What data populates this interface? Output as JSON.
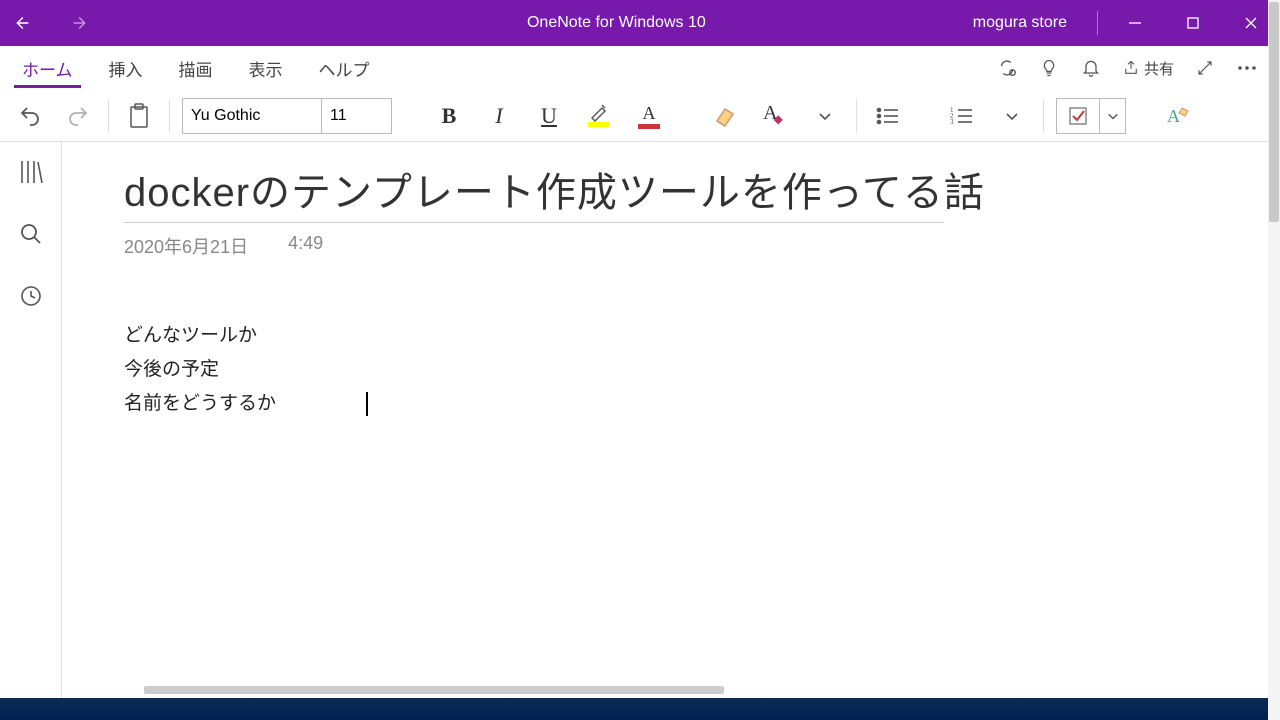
{
  "titlebar": {
    "app_title": "OneNote for Windows 10",
    "account": "mogura store"
  },
  "menu": {
    "tabs": [
      "ホーム",
      "挿入",
      "描画",
      "表示",
      "ヘルプ"
    ],
    "active_index": 0,
    "share_label": "共有"
  },
  "ribbon": {
    "font_name": "Yu Gothic",
    "font_size": "11",
    "highlight_color": "#FFFF00",
    "font_color": "#D13438"
  },
  "note": {
    "title": "dockerのテンプレート作成ツールを作ってる話",
    "date": "2020年6月21日",
    "time": "4:49",
    "lines": [
      "どんなツールか",
      "今後の予定",
      "名前をどうするか"
    ]
  }
}
